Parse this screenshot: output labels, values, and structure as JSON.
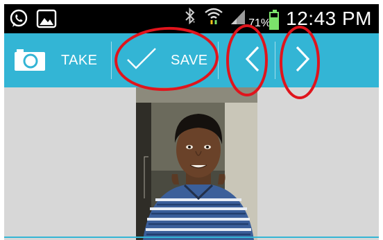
{
  "status_bar": {
    "battery_percent_text": "71%",
    "battery_level": 0.71,
    "time": "12:43 PM",
    "icons": [
      "whatsapp-icon",
      "image-notification-icon",
      "bluetooth-icon",
      "wifi-icon",
      "signal-icon",
      "battery-icon"
    ]
  },
  "action_bar": {
    "take_label": "TAKE",
    "save_label": "SAVE",
    "icons": [
      "camera-icon",
      "checkmark-icon",
      "chevron-left-icon",
      "chevron-right-icon"
    ],
    "accent_color": "#33b5d5"
  },
  "content": {
    "background_color": "#d7d7d7",
    "photo": "portrait-photo"
  },
  "annotations": {
    "color": "#e0141c",
    "highlighted": [
      "save-button",
      "previous-button",
      "next-button"
    ]
  }
}
